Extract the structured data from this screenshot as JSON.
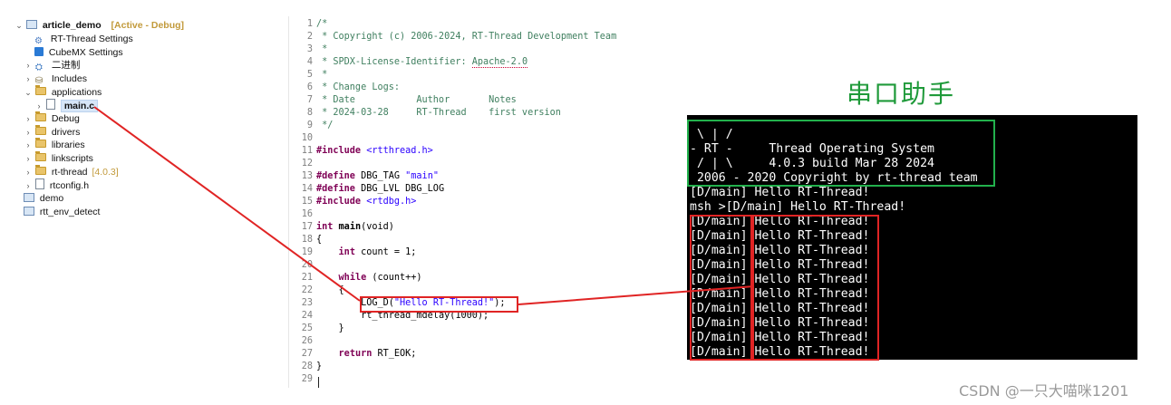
{
  "explorer": {
    "project": {
      "name": "article_demo",
      "tag": "[Active - Debug]"
    },
    "items": [
      {
        "label": "RT-Thread Settings",
        "icon": "gear-icon",
        "indent": 1
      },
      {
        "label": "CubeMX Settings",
        "icon": "cubemx-icon",
        "indent": 1
      },
      {
        "label": "二进制",
        "icon": "binary-icon",
        "indent": 1
      },
      {
        "label": "Includes",
        "icon": "includes-icon",
        "indent": 1
      },
      {
        "label": "applications",
        "icon": "folder-icon",
        "indent": 1
      },
      {
        "label": "main.c",
        "icon": "c-file-icon",
        "indent": 2
      },
      {
        "label": "Debug",
        "icon": "folder-icon",
        "indent": 1
      },
      {
        "label": "drivers",
        "icon": "folder-icon",
        "indent": 1
      },
      {
        "label": "libraries",
        "icon": "folder-icon",
        "indent": 1
      },
      {
        "label": "linkscripts",
        "icon": "folder-icon",
        "indent": 1
      },
      {
        "label": "rt-thread",
        "version": "[4.0.3]",
        "icon": "folder-icon",
        "indent": 1
      },
      {
        "label": "rtconfig.h",
        "icon": "h-file-icon",
        "indent": 1
      },
      {
        "label": "demo",
        "icon": "project-icon",
        "indent": 0
      },
      {
        "label": "rtt_env_detect",
        "icon": "project-icon",
        "indent": 0
      }
    ]
  },
  "editor": {
    "lines": [
      "1",
      "2",
      "3",
      "4",
      "5",
      "6",
      "7",
      "8",
      "9",
      "10",
      "11",
      "12",
      "13",
      "14",
      "15",
      "16",
      "17",
      "18",
      "19",
      "20",
      "21",
      "22",
      "23",
      "24",
      "25",
      "26",
      "27",
      "28",
      "29"
    ],
    "code": {
      "l1": "/*",
      "l2": " * Copyright (c) 2006-2024, RT-Thread Development Team",
      "l3": " *",
      "l4a": " * SPDX-License-Identifier: ",
      "l4b": "Apache-2.0",
      "l5": " *",
      "l6": " * Change Logs:",
      "l7": " * Date           Author       Notes",
      "l8": " * 2024-03-28     RT-Thread    first version",
      "l9": " */",
      "l11a": "#include ",
      "l11b": "<rtthread.h>",
      "l13a": "#define ",
      "l13b": "DBG_TAG ",
      "l13c": "\"main\"",
      "l14a": "#define ",
      "l14b": "DBG_LVL DBG_LOG",
      "l15a": "#include ",
      "l15b": "<rtdbg.h>",
      "l17a": "int ",
      "l17b": "main",
      "l17c": "(void)",
      "l18": "{",
      "l19a": "int ",
      "l19b": "count = 1;",
      "l21a": "while ",
      "l21b": "(count++)",
      "l22": "{",
      "l23a": "LOG_D(",
      "l23b": "\"Hello RT-Thread!\"",
      "l23c": ");",
      "l24": "rt_thread_mdelay(1000);",
      "l25": "}",
      "l27a": "return ",
      "l27b": "RT_EOK;",
      "l28": "}"
    }
  },
  "serial": {
    "title": "串口助手",
    "banner": [
      " \\ | /",
      "- RT -     Thread Operating System",
      " / | \\     4.0.3 build Mar 28 2024",
      " 2006 - 2020 Copyright by rt-thread team"
    ],
    "output": [
      "[D/main] Hello RT-Thread!",
      "msh >[D/main] Hello RT-Thread!",
      "[D/main] Hello RT-Thread!",
      "[D/main] Hello RT-Thread!",
      "[D/main] Hello RT-Thread!",
      "[D/main] Hello RT-Thread!",
      "[D/main] Hello RT-Thread!",
      "[D/main] Hello RT-Thread!",
      "[D/main] Hello RT-Thread!",
      "[D/main] Hello RT-Thread!",
      "[D/main] Hello RT-Thread!",
      "[D/main] Hello RT-Thread!"
    ]
  },
  "watermark": "CSDN @一只大喵咪1201",
  "colors": {
    "highlight": "#e02424",
    "banner_box": "#22b14c",
    "serial_title": "#1f9a3a",
    "terminal_bg": "#000000"
  }
}
